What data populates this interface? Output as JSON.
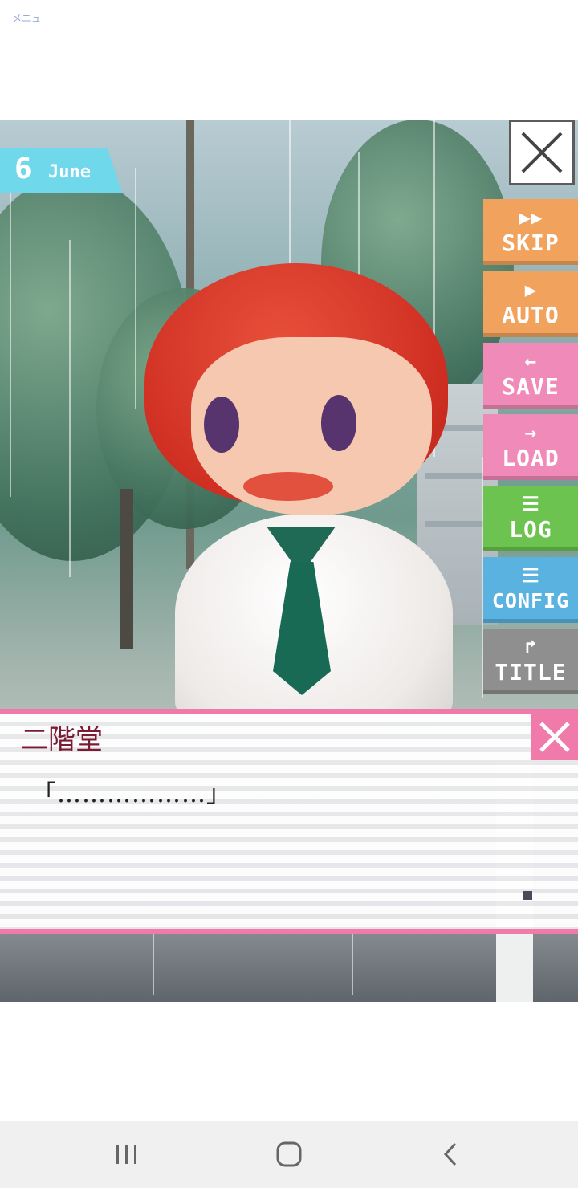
{
  "menu": {
    "label": "メニュー"
  },
  "date": {
    "day": "6",
    "month": "June"
  },
  "side_buttons": [
    {
      "id": "skip",
      "glyph": "▶▶",
      "label": "SKIP",
      "color": "#f1a35e"
    },
    {
      "id": "auto",
      "glyph": "▶",
      "label": "AUTO",
      "color": "#f1a35e"
    },
    {
      "id": "save",
      "glyph": "←",
      "label": "SAVE",
      "color": "#f08ab8"
    },
    {
      "id": "load",
      "glyph": "→",
      "label": "LOAD",
      "color": "#f08ab8"
    },
    {
      "id": "log",
      "glyph": "☰",
      "label": "LOG",
      "color": "#6cc34f"
    },
    {
      "id": "config",
      "glyph": "☰",
      "label": "CONFIG",
      "color": "#59b2e0"
    },
    {
      "id": "title",
      "glyph": "↱",
      "label": "TITLE",
      "color": "#8f8f8f"
    }
  ],
  "dialog": {
    "speaker": "二階堂",
    "text": "「………………」"
  },
  "colors": {
    "accent_pink": "#f07aa9",
    "speaker_color": "#7a1a33",
    "date_badge": "#6fd8ea"
  },
  "icons": {
    "close_top": "close-icon",
    "dialog_close": "close-icon",
    "nav_recents": "recents-icon",
    "nav_home": "home-icon",
    "nav_back": "back-icon"
  }
}
